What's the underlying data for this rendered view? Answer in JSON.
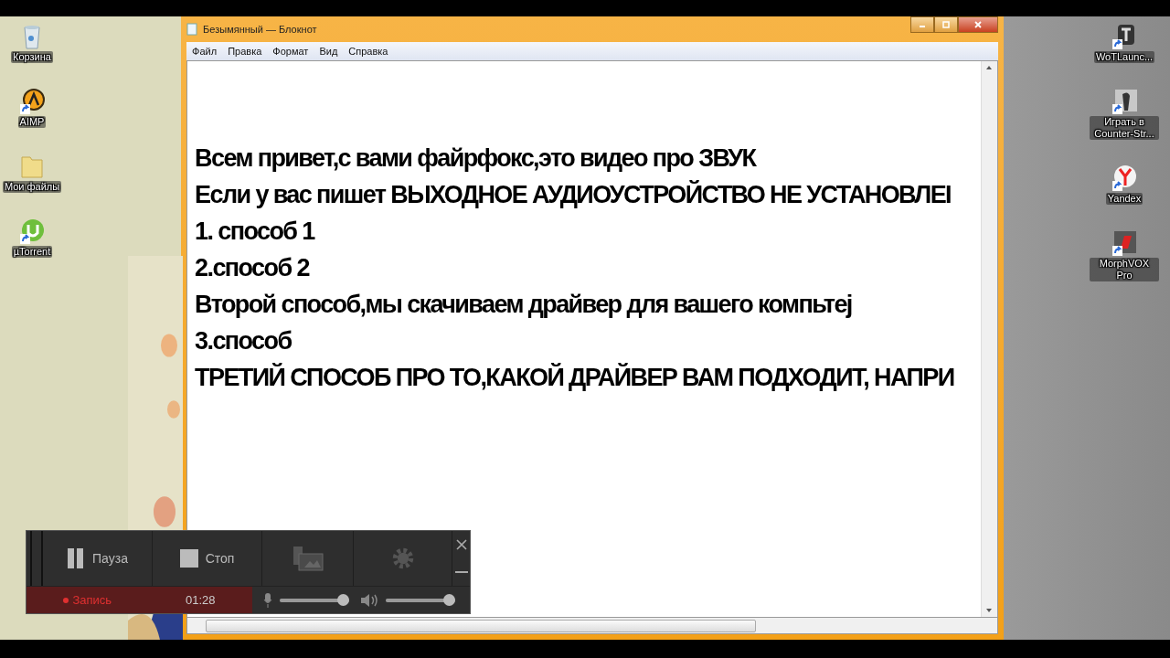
{
  "desktop_left": [
    {
      "label": "Корзина",
      "kind": "bin",
      "shortcut": false
    },
    {
      "label": "AIMP",
      "kind": "aimp",
      "shortcut": true
    },
    {
      "label": "Мои файлы",
      "kind": "folder",
      "shortcut": false
    },
    {
      "label": "µTorrent",
      "kind": "torrent",
      "shortcut": true
    }
  ],
  "desktop_right": [
    {
      "label": "WoTLaunc...",
      "kind": "wot",
      "shortcut": true
    },
    {
      "label": "Играть в Counter-Str...",
      "kind": "cs",
      "shortcut": true
    },
    {
      "label": "Yandex",
      "kind": "yandex",
      "shortcut": true
    },
    {
      "label": "MorphVOX Pro",
      "kind": "morph",
      "shortcut": true
    }
  ],
  "window": {
    "title": "Безымянный — Блокнот"
  },
  "menu": [
    "Файл",
    "Правка",
    "Формат",
    "Вид",
    "Справка"
  ],
  "document": {
    "lines": [
      "Всем привет,с вами файрфокс,это видео про ЗВУК",
      "Если у вас пишет ВЫХОДНОЕ АУДИОУСТРОЙСТВО НЕ УСТАНОВЛЕI",
      "1. способ 1",
      "2.способ 2",
      "Второй способ,мы скачиваем драйвер для вашего компьтеј",
      "3.способ",
      "ТРЕТИЙ СПОСОБ ПРО ТО,КАКОЙ ДРАЙВЕР ВАМ ПОДХОДИТ, НАПРИ"
    ]
  },
  "recorder": {
    "pause": "Пауза",
    "stop": "Стоп",
    "status": "Запись",
    "time": "01:28",
    "mic": {
      "level": 1
    },
    "volume": {
      "level": 1
    }
  }
}
